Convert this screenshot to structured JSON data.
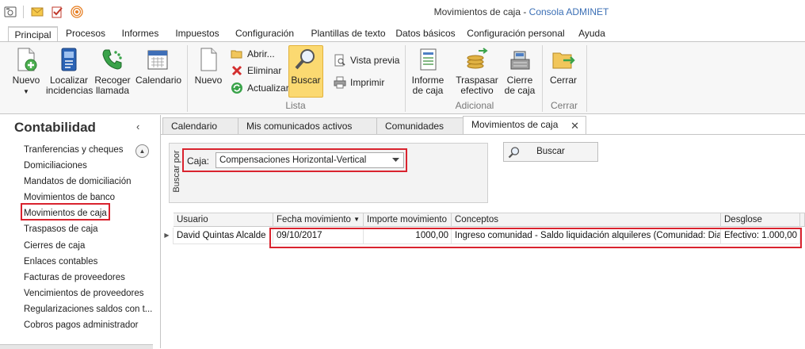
{
  "window": {
    "title": "Movimientos de caja",
    "separator": " - ",
    "app_name": "Consola ADMINET"
  },
  "ribbon_tabs": [
    "Principal",
    "Procesos",
    "Informes",
    "Impuestos",
    "Configuración",
    "Plantillas de texto",
    "Datos básicos",
    "Configuración personal",
    "Ayuda"
  ],
  "ribbon": {
    "nuevo_main": "Nuevo",
    "localizar": [
      "Localizar",
      "incidencias"
    ],
    "recoger": [
      "Recoger",
      "llamada"
    ],
    "calendario": "Calendario",
    "lista": {
      "nuevo": "Nuevo",
      "abrir": "Abrir...",
      "eliminar": "Eliminar",
      "actualizar": "Actualizar",
      "buscar": "Buscar",
      "vista_previa": "Vista previa",
      "imprimir": "Imprimir",
      "group": "Lista"
    },
    "adicional": {
      "informe": [
        "Informe",
        "de caja"
      ],
      "traspasar": [
        "Traspasar",
        "efectivo"
      ],
      "cierre": [
        "Cierre",
        "de caja"
      ],
      "group": "Adicional"
    },
    "cerrar": {
      "label": "Cerrar",
      "group": "Cerrar"
    }
  },
  "nav": {
    "title": "Contabilidad",
    "items": [
      "Tranferencias y cheques",
      "Domiciliaciones",
      "Mandatos de domiciliación",
      "Movimientos de banco",
      "Movimientos de caja",
      "Traspasos de caja",
      "Cierres de caja",
      "Enlaces contables",
      "Facturas de proveedores",
      "Vencimientos de proveedores",
      "Regularizaciones saldos con t...",
      "Cobros pagos administrador"
    ]
  },
  "doc_tabs": [
    "Calendario",
    "Mis comunicados activos",
    "Comunidades",
    "Movimientos de caja"
  ],
  "search": {
    "vertical_label": "Buscar por",
    "caja_label": "Caja:",
    "caja_value": "Compensaciones Horizontal-Vertical",
    "button": "Buscar"
  },
  "grid": {
    "columns": [
      "Usuario",
      "Fecha movimiento",
      "Importe movimiento",
      "Conceptos",
      "Desglose"
    ],
    "rows": [
      {
        "usuario": "David Quintas Alcalde",
        "fecha": "09/10/2017",
        "importe": "1000,00",
        "conceptos": "Ingreso comunidad - Saldo liquidación alquileres (Comunidad: Diago...",
        "desglose": "Efectivo: 1.000,00"
      }
    ]
  },
  "colors": {
    "accent_red": "#d9232e",
    "active_button": "#fbd971",
    "link_blue": "#3b6fb5"
  }
}
